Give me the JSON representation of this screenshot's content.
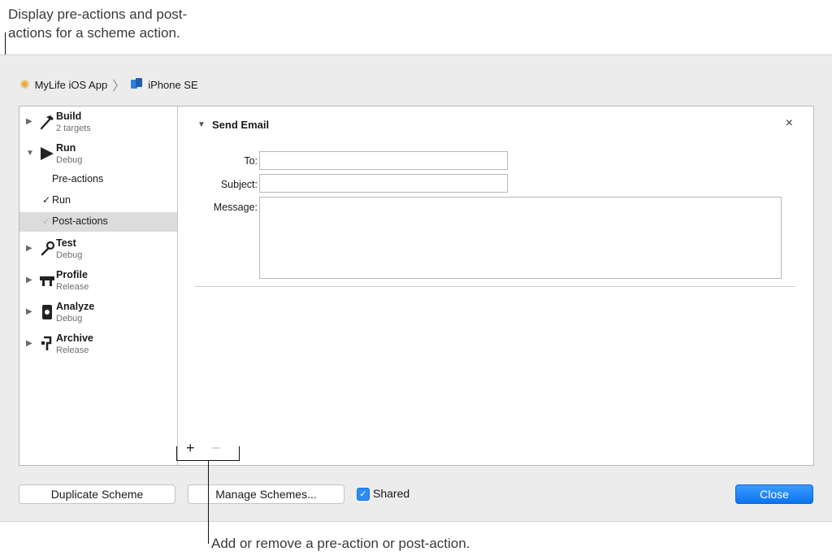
{
  "callouts": {
    "top_line1": "Display pre-actions and post-",
    "top_line2": "actions for a scheme action.",
    "bottom": "Add or remove a pre-action or post-action."
  },
  "breadcrumb": {
    "project": "MyLife iOS App",
    "separator": "〉",
    "device": "iPhone SE"
  },
  "sidebar": {
    "actions": [
      {
        "title": "Build",
        "subtitle": "2 targets",
        "icon": "hammer-icon",
        "expanded": false
      },
      {
        "title": "Run",
        "subtitle": "Debug",
        "icon": "play-icon",
        "expanded": true
      },
      {
        "title": "Test",
        "subtitle": "Debug",
        "icon": "wrench-icon",
        "expanded": false
      },
      {
        "title": "Profile",
        "subtitle": "Release",
        "icon": "gauge-icon",
        "expanded": false
      },
      {
        "title": "Analyze",
        "subtitle": "Debug",
        "icon": "analyze-icon",
        "expanded": false
      },
      {
        "title": "Archive",
        "subtitle": "Release",
        "icon": "archive-icon",
        "expanded": false
      }
    ],
    "run_subitems": [
      {
        "label": "Pre-actions",
        "checked": false,
        "selected": false
      },
      {
        "label": "Run",
        "checked": true,
        "selected": false
      },
      {
        "label": "Post-actions",
        "checked": true,
        "selected": true
      }
    ]
  },
  "content": {
    "section_title": "Send Email",
    "close_glyph": "×",
    "to_label": "To:",
    "to_value": "",
    "subject_label": "Subject:",
    "subject_value": "",
    "message_label": "Message:",
    "message_value": "",
    "add_glyph": "+",
    "remove_glyph": "−"
  },
  "buttons": {
    "duplicate": "Duplicate Scheme",
    "manage": "Manage Schemes...",
    "shared_label": "Shared",
    "shared_checked": true,
    "close": "Close"
  },
  "colors": {
    "accent": "#0b74f0",
    "selection": "#dcdcdc"
  }
}
